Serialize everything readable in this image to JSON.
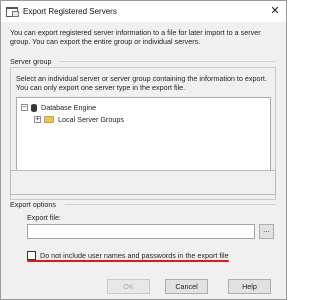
{
  "window": {
    "title": "Export Registered Servers",
    "close_glyph": "✕"
  },
  "intro_text": "You can export registered server information to a file for later import to a server group. You can export the entire group or individual servers.",
  "server_group": {
    "label": "Server group",
    "description": "Select an individual server or server group containing the information to export. You can only export one server type in the export file.",
    "tree": [
      {
        "label": "Database Engine",
        "expander": "−",
        "icon": "database-icon"
      },
      {
        "label": "Local Server Groups",
        "expander": "+",
        "icon": "folder-icon"
      }
    ]
  },
  "export_options": {
    "label": "Export options",
    "file_label": "Export file:",
    "file_value": "",
    "browse_label": "...",
    "exclude_credentials": {
      "label": "Do not include user names and passwords in the export file",
      "checked": false
    }
  },
  "buttons": {
    "ok": "OK",
    "cancel": "Cancel",
    "help": "Help"
  },
  "colors": {
    "highlight_underline": "#e01818"
  }
}
